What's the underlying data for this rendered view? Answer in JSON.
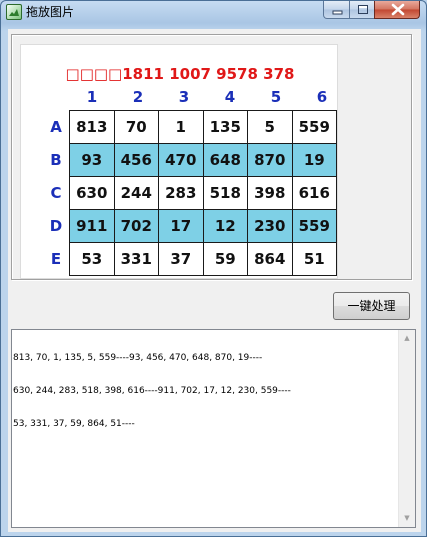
{
  "window": {
    "title": "拖放图片",
    "icon": "picture-app-icon",
    "controls": [
      "minimize-icon",
      "maximize-icon",
      "close-icon"
    ]
  },
  "image": {
    "title": "□□□□1811 1007 9578 378",
    "column_headers": [
      "1",
      "2",
      "3",
      "4",
      "5",
      "6"
    ],
    "row_headers": [
      "A",
      "B",
      "C",
      "D",
      "E"
    ],
    "rows": [
      [
        "813",
        "70",
        "1",
        "135",
        "5",
        "559"
      ],
      [
        "93",
        "456",
        "470",
        "648",
        "870",
        "19"
      ],
      [
        "630",
        "244",
        "283",
        "518",
        "398",
        "616"
      ],
      [
        "911",
        "702",
        "17",
        "12",
        "230",
        "559"
      ],
      [
        "53",
        "331",
        "37",
        "59",
        "864",
        "51"
      ]
    ],
    "highlighted_rows": [
      "B",
      "D"
    ],
    "colors": {
      "title": "#e01818",
      "headers": "#1b2fb8",
      "highlight": "#7ed0e6"
    }
  },
  "actions": {
    "process_label": "一键处理"
  },
  "output": {
    "lines": [
      "813, 70, 1, 135, 5, 559----93, 456, 470, 648, 870, 19----",
      "630, 244, 283, 518, 398, 616----911, 702, 17, 12, 230, 559----",
      "53, 331, 37, 59, 864, 51----"
    ]
  }
}
